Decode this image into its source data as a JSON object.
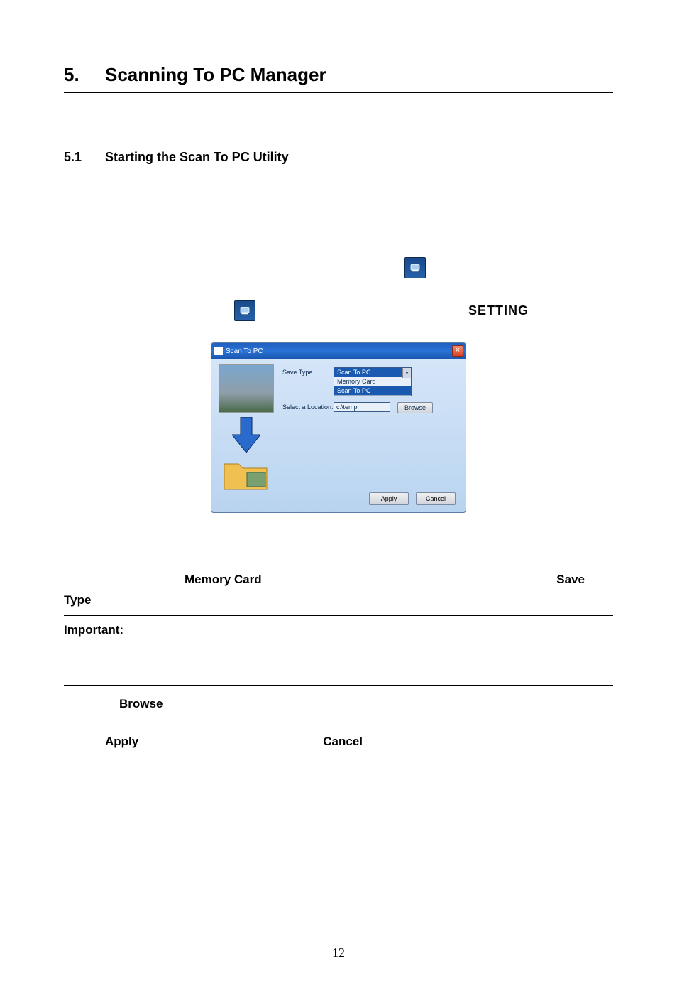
{
  "heading1": {
    "number": "5.",
    "title": "Scanning To PC Manager"
  },
  "heading2": {
    "number": "5.1",
    "title": "Starting the Scan To PC Utility"
  },
  "setting_label": "SETTING",
  "dialog": {
    "title": "Scan To PC",
    "close_glyph": "×",
    "save_type_label": "Save Type",
    "options": {
      "scan_to_pc": "Scan To PC",
      "memory_card": "Memory Card",
      "scan_to_pc2": "Scan To PC"
    },
    "location_label": "Select a Location:",
    "location_value": "c:\\temp",
    "browse": "Browse",
    "apply": "Apply",
    "cancel": "Cancel",
    "caret": "▼"
  },
  "body_text": {
    "memory_card": "Memory Card",
    "save": "Save",
    "type": "Type",
    "important": "Important:",
    "browse": "Browse",
    "apply": "Apply",
    "cancel": "Cancel"
  },
  "page_number": "12"
}
